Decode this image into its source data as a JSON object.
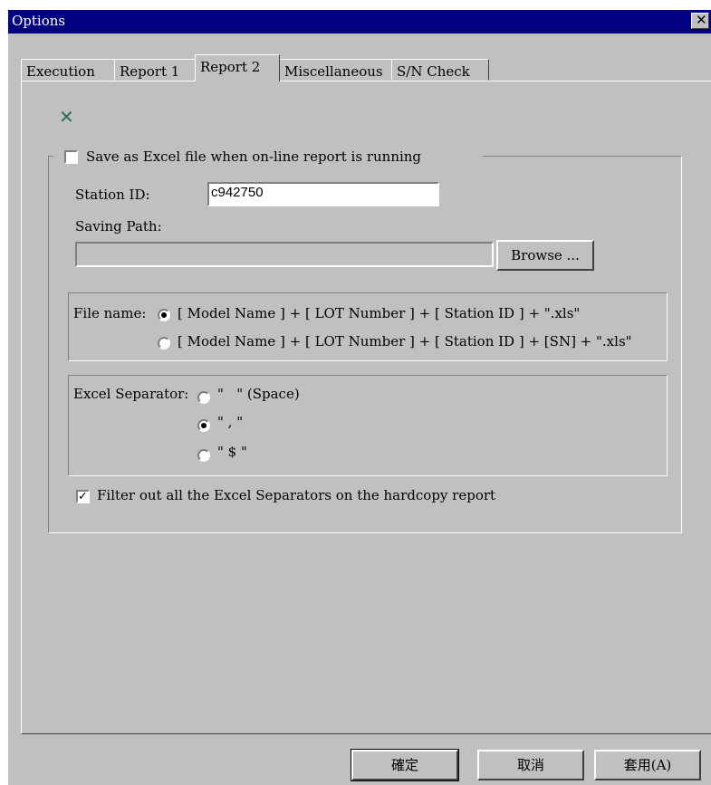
{
  "window": {
    "title": "Options",
    "close_glyph": "✕"
  },
  "tabs": [
    {
      "label": "Execution",
      "active": false
    },
    {
      "label": "Report 1",
      "active": false
    },
    {
      "label": "Report 2",
      "active": true
    },
    {
      "label": "Miscellaneous",
      "active": false
    },
    {
      "label": "S/N Check",
      "active": false
    }
  ],
  "report2": {
    "icon": "excel-icon",
    "save_excel": {
      "label": "Save as Excel file when on-line report is running",
      "checked": false
    },
    "station_id": {
      "label": "Station ID:",
      "value": "c942750"
    },
    "saving_path": {
      "label": "Saving Path:",
      "value": ""
    },
    "browse_label": "Browse ...",
    "file_name": {
      "label": "File name:",
      "options": [
        {
          "label": "[ Model Name ] + [ LOT Number ] + [ Station ID ] + \".xls\"",
          "selected": true
        },
        {
          "label": "[ Model Name ] + [ LOT Number ] + [ Station ID ] + [SN] + \".xls\"",
          "selected": false
        }
      ]
    },
    "excel_separator": {
      "label": "Excel Separator:",
      "options": [
        {
          "label": "\"   \" (Space)",
          "selected": false
        },
        {
          "label": "\" , \"",
          "selected": true
        },
        {
          "label": "\" $ \"",
          "selected": false
        }
      ]
    },
    "filter_separators": {
      "label": "Filter out all the Excel Separators on the hardcopy report",
      "checked": true
    }
  },
  "buttons": {
    "ok": "確定",
    "cancel": "取消",
    "apply": "套用(A)"
  }
}
